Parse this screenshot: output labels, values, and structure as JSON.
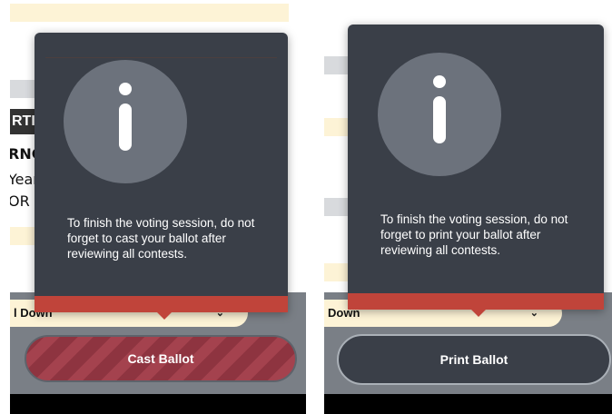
{
  "left_screen": {
    "background_fragments": [
      "RTIS",
      "RNC",
      "Year",
      "OR C"
    ],
    "dropdown_text": "l Down",
    "dropdown_chevron": "⌄",
    "modal": {
      "icon": "info-icon",
      "message": "To finish the voting session, do not forget to cast your ballot after reviewing all contests."
    },
    "button_label": "Cast Ballot"
  },
  "right_screen": {
    "dropdown_text": "Down",
    "dropdown_chevron": "⌄",
    "modal": {
      "icon": "info-icon",
      "message": "To finish the voting session, do not forget to print your ballot after reviewing all contests."
    },
    "button_label": "Print Ballot"
  },
  "colors": {
    "modal_bg": "#3a3f48",
    "modal_accent": "#c0443a",
    "info_circle": "#6c727c",
    "cast_button": "#8e3440",
    "background_yellow": "#fdf3d6"
  }
}
